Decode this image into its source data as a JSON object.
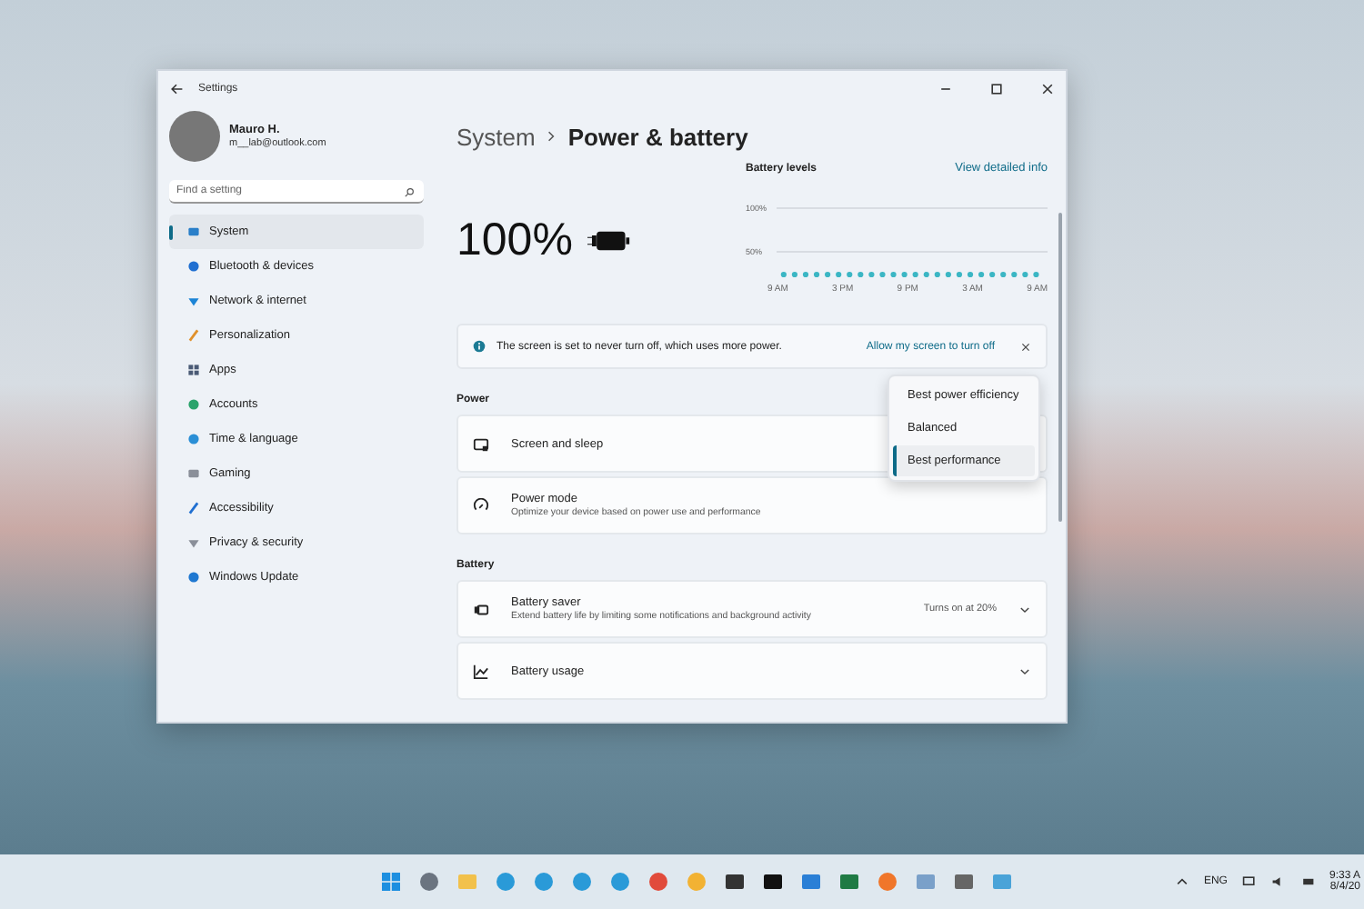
{
  "window": {
    "title": "Settings"
  },
  "user": {
    "name": "Mauro H.",
    "email": "m__lab@outlook.com"
  },
  "search": {
    "placeholder": "Find a setting"
  },
  "sidebar": {
    "items": [
      {
        "label": "System",
        "selected": true
      },
      {
        "label": "Bluetooth & devices",
        "selected": false
      },
      {
        "label": "Network & internet",
        "selected": false
      },
      {
        "label": "Personalization",
        "selected": false
      },
      {
        "label": "Apps",
        "selected": false
      },
      {
        "label": "Accounts",
        "selected": false
      },
      {
        "label": "Time & language",
        "selected": false
      },
      {
        "label": "Gaming",
        "selected": false
      },
      {
        "label": "Accessibility",
        "selected": false
      },
      {
        "label": "Privacy & security",
        "selected": false
      },
      {
        "label": "Windows Update",
        "selected": false
      }
    ]
  },
  "breadcrumb": {
    "parent": "System",
    "current": "Power & battery"
  },
  "battery": {
    "percent": "100%"
  },
  "battery_levels": {
    "title": "Battery levels",
    "link": "View detailed info",
    "y_labels": [
      "100%",
      "50%"
    ],
    "x_labels": [
      "9 AM",
      "3 PM",
      "9 PM",
      "3 AM",
      "9 AM"
    ]
  },
  "notice": {
    "text": "The screen is set to never turn off, which uses more power.",
    "action": "Allow my screen to turn off"
  },
  "sections": [
    {
      "heading": "Power",
      "rows": [
        {
          "kind": "plain",
          "title": "Screen and sleep"
        },
        {
          "kind": "plain",
          "title": "Power mode",
          "subtitle": "Optimize your device based on power use and performance"
        }
      ]
    },
    {
      "heading": "Battery",
      "rows": [
        {
          "kind": "expander",
          "title": "Battery saver",
          "subtitle": "Extend battery life by limiting some notifications and background activity",
          "value": "Turns on at 20%"
        },
        {
          "kind": "expander",
          "title": "Battery usage"
        }
      ]
    }
  ],
  "power_mode_menu": {
    "options": [
      {
        "label": "Best power efficiency",
        "selected": false
      },
      {
        "label": "Balanced",
        "selected": false
      },
      {
        "label": "Best performance",
        "selected": true
      }
    ]
  },
  "taskbar": {
    "language": "ENG",
    "time": "9:33 A",
    "date": "8/4/20"
  }
}
